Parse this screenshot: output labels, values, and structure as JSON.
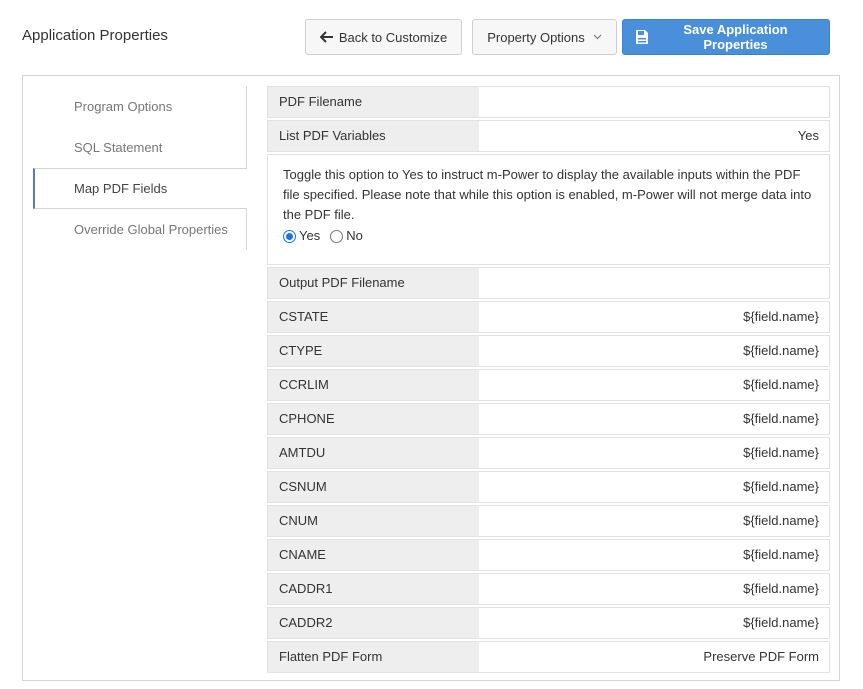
{
  "header": {
    "title": "Application Properties",
    "back_label": "Back to Customize",
    "property_options_label": "Property Options",
    "save_label": "Save Application Properties"
  },
  "colors": {
    "accent": "#4a8fd9",
    "active_tab_border": "#5a7fa8",
    "label_bg": "#eeeeee"
  },
  "icons": {
    "back": "arrow-left-icon",
    "dropdown": "chevron-down-icon",
    "save": "save-document-icon"
  },
  "sidebar": {
    "items": [
      {
        "label": "Program Options"
      },
      {
        "label": "SQL Statement"
      },
      {
        "label": "Map PDF Fields",
        "active": true
      },
      {
        "label": "Override Global Properties"
      }
    ]
  },
  "form": {
    "pdf_filename": {
      "label": "PDF Filename",
      "value": ""
    },
    "list_pdf_variables": {
      "label": "List PDF Variables",
      "value": "Yes",
      "help": "Toggle this option to Yes to instruct m-Power to display the available inputs within the PDF file specified. Please note that while this option is enabled, m-Power will not merge data into the PDF file.",
      "yes_label": "Yes",
      "no_label": "No",
      "selected": "Yes"
    },
    "output_pdf_filename": {
      "label": "Output PDF Filename",
      "value": ""
    },
    "fields": [
      {
        "label": "CSTATE",
        "value": "${field.name}"
      },
      {
        "label": "CTYPE",
        "value": "${field.name}"
      },
      {
        "label": "CCRLIM",
        "value": "${field.name}"
      },
      {
        "label": "CPHONE",
        "value": "${field.name}"
      },
      {
        "label": "AMTDU",
        "value": "${field.name}"
      },
      {
        "label": "CSNUM",
        "value": "${field.name}"
      },
      {
        "label": "CNUM",
        "value": "${field.name}"
      },
      {
        "label": "CNAME",
        "value": "${field.name}"
      },
      {
        "label": "CADDR1",
        "value": "${field.name}"
      },
      {
        "label": "CADDR2",
        "value": "${field.name}"
      }
    ],
    "flatten": {
      "label": "Flatten PDF Form",
      "value": "Preserve PDF Form"
    }
  }
}
